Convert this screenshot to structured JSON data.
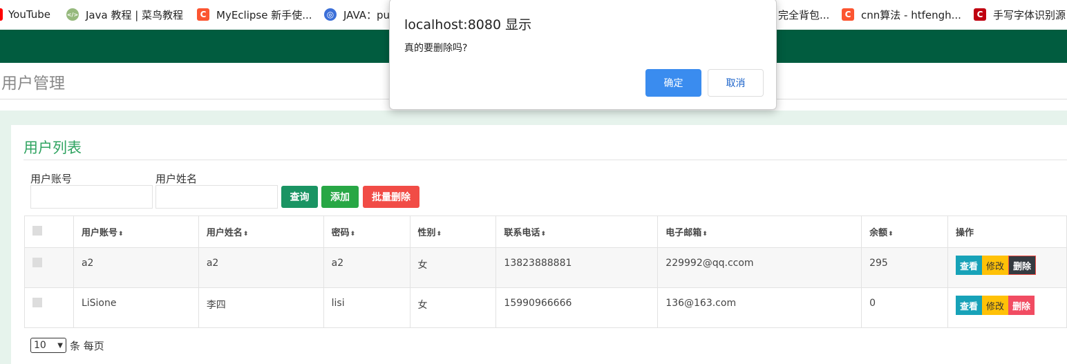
{
  "bookmarks": [
    {
      "label": "YouTube",
      "icon": "youtube-icon",
      "color": "#ff0000"
    },
    {
      "label": "Java 教程 | 菜鸟教程",
      "icon": "runoob-icon",
      "color": "#96b97d"
    },
    {
      "label": "MyEclipse 新手使...",
      "icon": "csdn-icon",
      "color": "#fc5531"
    },
    {
      "label": "JAVA：pu",
      "icon": "globe-icon",
      "color": "#3b6fd8"
    },
    {
      "label": "完全背包...",
      "icon": "",
      "color": ""
    },
    {
      "label": "cnn算法 - htfengh...",
      "icon": "csdn-icon",
      "color": "#fc5531"
    },
    {
      "label": "手写字体识别源",
      "icon": "c-icon",
      "color": "#c00010"
    }
  ],
  "page": {
    "title": "用户管理"
  },
  "panel": {
    "title": "用户列表"
  },
  "filters": {
    "account_label": "用户账号",
    "name_label": "用户姓名",
    "account_value": "",
    "name_value": ""
  },
  "buttons": {
    "query": "查询",
    "add": "添加",
    "batch_delete": "批量删除"
  },
  "table": {
    "headers": [
      "用户账号",
      "用户姓名",
      "密码",
      "性别",
      "联系电话",
      "电子邮箱",
      "余额",
      "操作"
    ],
    "sort_glyph": "⬍",
    "rows": [
      {
        "account": "a2",
        "name": "a2",
        "password": "a2",
        "gender": "女",
        "phone": "13823888881",
        "email": "229992@qq.ccom",
        "balance": "295"
      },
      {
        "account": "LiSione",
        "name": "李四",
        "password": "lisi",
        "gender": "女",
        "phone": "15990966666",
        "email": "136@163.com",
        "balance": "0"
      }
    ],
    "actions": {
      "view": "查看",
      "edit": "修改",
      "delete": "删除"
    }
  },
  "pager": {
    "page_size": "10",
    "suffix": "条 每页"
  },
  "dialog": {
    "title": "localhost:8080 显示",
    "message": "真的要删除吗?",
    "ok": "确定",
    "cancel": "取消"
  },
  "colors": {
    "header_green": "#015c3f",
    "accent_green": "#2fa360",
    "query_btn": "#1a9463",
    "add_btn": "#28a745",
    "danger": "#f14c46",
    "info": "#17a2b8",
    "warning": "#ffc107",
    "dark": "#343a40",
    "dialog_ok": "#3a8cef"
  }
}
